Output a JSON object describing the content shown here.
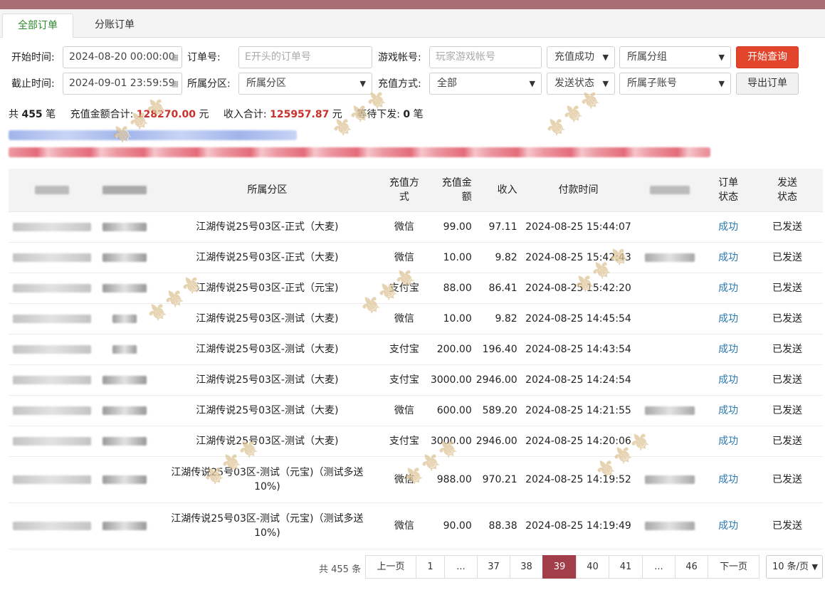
{
  "tabs": [
    {
      "label": "全部订单",
      "active": true
    },
    {
      "label": "分账订单",
      "active": false
    }
  ],
  "filters": {
    "start_label": "开始时间:",
    "start_value": "2024-08-20 00:00:00",
    "end_label": "截止时间:",
    "end_value": "2024-09-01 23:59:59",
    "order_label": "订单号:",
    "order_placeholder": "E开头的订单号",
    "zone_label": "所属分区:",
    "zone_value": "所属分区",
    "account_label": "游戏帐号:",
    "account_placeholder": "玩家游戏帐号",
    "pay_label": "充值方式:",
    "pay_value": "全部",
    "status_value": "充值成功",
    "send_value": "发送状态",
    "group_value": "所属分组",
    "subaccount_value": "所属子账号",
    "query_button": "开始查询",
    "export_button": "导出订单"
  },
  "summary": {
    "total_prefix": "共",
    "total_count": "455",
    "total_suffix": "笔",
    "amount_label": "充值金额合计:",
    "amount_value": "128270.00",
    "amount_unit": "元",
    "income_label": "收入合计:",
    "income_value": "125957.87",
    "income_unit": "元",
    "pending_label": "等待下发:",
    "pending_value": "0",
    "pending_unit": "笔"
  },
  "table": {
    "headers": [
      "",
      "",
      "所属分区",
      "充值方式",
      "充值金额",
      "收入",
      "付款时间",
      "",
      "订单状态",
      "发送状态"
    ],
    "rows": [
      {
        "zone": "江湖传说25号03区-正式（大麦)",
        "pay": "微信",
        "amount": "99.00",
        "income": "97.11",
        "time": "2024-08-25 15:44:07",
        "status": "成功",
        "send": "已发送"
      },
      {
        "zone": "江湖传说25号03区-正式（大麦)",
        "pay": "微信",
        "amount": "10.00",
        "income": "9.82",
        "time": "2024-08-25 15:42:43",
        "status": "成功",
        "send": "已发送"
      },
      {
        "zone": "江湖传说25号03区-正式（元宝)",
        "pay": "支付宝",
        "amount": "88.00",
        "income": "86.41",
        "time": "2024-08-25 15:42:20",
        "status": "成功",
        "send": "已发送"
      },
      {
        "zone": "江湖传说25号03区-测试（大麦)",
        "pay": "微信",
        "amount": "10.00",
        "income": "9.82",
        "time": "2024-08-25 14:45:54",
        "status": "成功",
        "send": "已发送"
      },
      {
        "zone": "江湖传说25号03区-测试（大麦)",
        "pay": "支付宝",
        "amount": "200.00",
        "income": "196.40",
        "time": "2024-08-25 14:43:54",
        "status": "成功",
        "send": "已发送"
      },
      {
        "zone": "江湖传说25号03区-测试（大麦)",
        "pay": "支付宝",
        "amount": "3000.00",
        "income": "2946.00",
        "time": "2024-08-25 14:24:54",
        "status": "成功",
        "send": "已发送"
      },
      {
        "zone": "江湖传说25号03区-测试（大麦)",
        "pay": "微信",
        "amount": "600.00",
        "income": "589.20",
        "time": "2024-08-25 14:21:55",
        "status": "成功",
        "send": "已发送"
      },
      {
        "zone": "江湖传说25号03区-测试（大麦)",
        "pay": "支付宝",
        "amount": "3000.00",
        "income": "2946.00",
        "time": "2024-08-25 14:20:06",
        "status": "成功",
        "send": "已发送"
      },
      {
        "zone": "江湖传说25号03区-测试（元宝)（测试多送10%)",
        "pay": "微信",
        "amount": "988.00",
        "income": "970.21",
        "time": "2024-08-25 14:19:52",
        "status": "成功",
        "send": "已发送"
      },
      {
        "zone": "江湖传说25号03区-测试（元宝)（测试多送10%)",
        "pay": "微信",
        "amount": "90.00",
        "income": "88.38",
        "time": "2024-08-25 14:19:49",
        "status": "成功",
        "send": "已发送"
      }
    ]
  },
  "pagination": {
    "total": "共 455 条",
    "prev": "上一页",
    "next": "下一页",
    "pages": [
      "1",
      "...",
      "37",
      "38",
      "39",
      "40",
      "41",
      "...",
      "46"
    ],
    "current": "39",
    "page_size": "10 条/页"
  },
  "colors": {
    "topbar": "#a86e76",
    "current_page": "#a23e49",
    "query_button": "#e2452b",
    "status_link": "#2a7ab0",
    "summary_red": "#c9302c"
  },
  "icons": [
    "calendar-icon",
    "chevron-down-icon"
  ]
}
